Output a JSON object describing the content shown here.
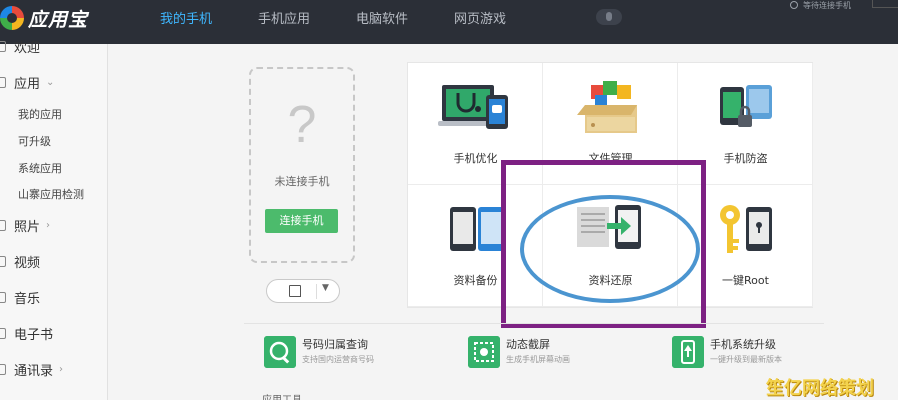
{
  "app": {
    "title": "应用宝"
  },
  "nav": {
    "tabs": [
      "我的手机",
      "手机应用",
      "电脑软件",
      "网页游戏"
    ],
    "active_index": 0
  },
  "status": {
    "text": "等待连接手机"
  },
  "sidebar": {
    "items": [
      {
        "label": "欢迎"
      },
      {
        "label": "应用",
        "arrow": "⌄"
      },
      {
        "label": "照片",
        "arrow": "›"
      },
      {
        "label": "视频"
      },
      {
        "label": "音乐"
      },
      {
        "label": "电子书"
      },
      {
        "label": "通讯录",
        "arrow": "›"
      }
    ],
    "sub_items": [
      "我的应用",
      "可升级",
      "系统应用",
      "山寨应用检测"
    ]
  },
  "phone_card": {
    "question_mark": "?",
    "status": "未连接手机",
    "connect_button": "连接手机"
  },
  "tools": [
    {
      "label": "手机优化",
      "icon": "phone-optimize-icon"
    },
    {
      "label": "文件管理",
      "icon": "file-manage-icon"
    },
    {
      "label": "手机防盗",
      "icon": "anti-theft-icon"
    },
    {
      "label": "资料备份",
      "icon": "data-backup-icon"
    },
    {
      "label": "资料还原",
      "icon": "data-restore-icon"
    },
    {
      "label": "一键Root",
      "icon": "one-key-root-icon"
    }
  ],
  "features": [
    {
      "title": "号码归属查询",
      "desc": "支持国内运营商号码",
      "icon": "phone-lookup-icon"
    },
    {
      "title": "动态截屏",
      "desc": "生成手机屏幕动画",
      "icon": "dynamic-screenshot-icon"
    },
    {
      "title": "手机系统升级",
      "desc": "一键升级到最新版本",
      "icon": "system-upgrade-icon"
    }
  ],
  "section_app_tools": "应用工具",
  "watermark": "笙亿网络策划",
  "colors": {
    "topbar": "#2b2f37",
    "accent": "#3fb7ff",
    "green": "#4cbb6c",
    "annotation_purple": "#7d2183",
    "annotation_blue": "#4b95d0"
  }
}
